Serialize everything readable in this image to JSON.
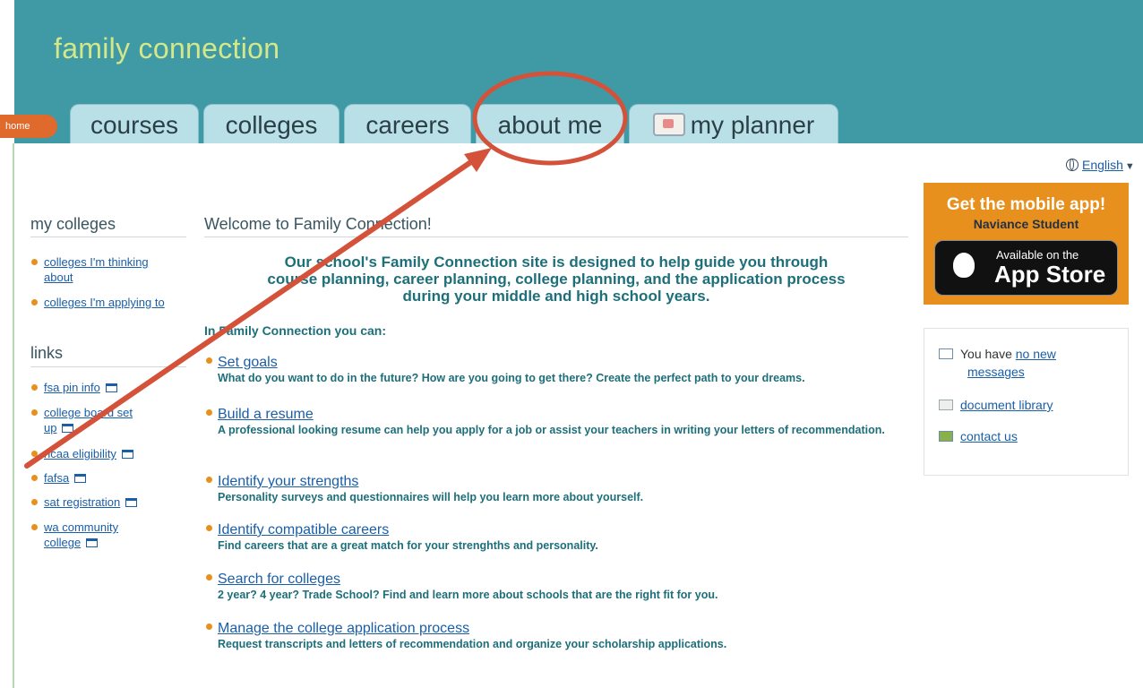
{
  "header": {
    "title": "family connection",
    "home": "home",
    "tabs": [
      "courses",
      "colleges",
      "careers",
      "about me",
      "my planner"
    ]
  },
  "language": {
    "label": "English"
  },
  "app_ad": {
    "title": "Get the mobile app!",
    "subtitle": "Naviance Student",
    "available": "Available on the",
    "store": "App Store"
  },
  "messages": {
    "you_have": "You have",
    "new_messages_l1": "no new",
    "new_messages_l2": "messages",
    "document_library": "document library",
    "contact_us": "contact us"
  },
  "sidebar": {
    "my_colleges_heading": "my colleges",
    "my_colleges": [
      {
        "line1": "colleges I'm thinking",
        "line2": "about"
      },
      {
        "line1": "colleges I'm applying to"
      }
    ],
    "links_heading": "links",
    "links": [
      {
        "line1": "fsa pin info"
      },
      {
        "line1": "college board set",
        "line2": "up"
      },
      {
        "line1": "ncaa eligibility"
      },
      {
        "line1": "fafsa"
      },
      {
        "line1": "sat registration"
      },
      {
        "line1": "wa community",
        "line2": "college"
      }
    ]
  },
  "main": {
    "heading": "Welcome to Family Connection!",
    "intro_lines": [
      "Our school's Family Connection site is designed to help guide you through",
      "course planning, career planning, college planning, and the application process",
      "during your middle and high school years."
    ],
    "can_heading": "In Family Connection you can:",
    "features": [
      {
        "title": "Set goals",
        "desc": "What do you want to do in the future? How are you going to get there? Create the perfect path to your dreams."
      },
      {
        "title": "Build a resume",
        "desc": "A professional looking resume can help you apply for a job or assist your teachers in writing your letters of recommendation."
      },
      {
        "title": "Identify your strengths",
        "desc": "Personality surveys and questionnaires will help you learn more about yourself."
      },
      {
        "title": "Identify compatible careers",
        "desc": "Find careers that are a great match for your strenghths and personality."
      },
      {
        "title": "Search for colleges",
        "desc": "2 year? 4 year? Trade School? Find and learn more about schools that are the right fit for you."
      },
      {
        "title": "Manage the college application process",
        "desc": "Request transcripts and letters of recommendation and organize your scholarship applications."
      }
    ]
  },
  "colors": {
    "header_bg": "#3f9aa6",
    "title": "#d4e88a",
    "tab_bg": "#b9e0e7",
    "accent_orange": "#e8901e",
    "link": "#1a5ea8",
    "teal_text": "#1d6f7a",
    "annotation_red": "#d4513a"
  }
}
